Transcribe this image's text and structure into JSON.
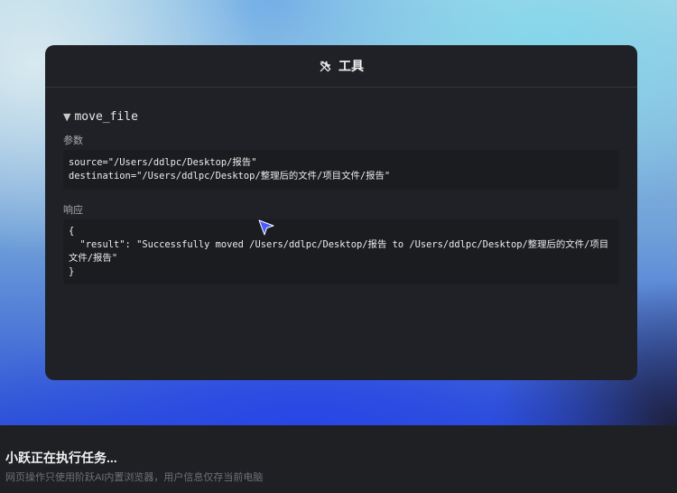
{
  "panel": {
    "title": "工具",
    "title_icon": "tools-icon",
    "function_name": "move_file",
    "collapse_icon": "triangle-down-icon",
    "params_label": "参数",
    "params_lines": [
      "source=\"/Users/ddlpc/Desktop/报告\"",
      "destination=\"/Users/ddlpc/Desktop/整理后的文件/项目文件/报告\""
    ],
    "response_label": "响应",
    "response_lines": [
      "{",
      "  \"result\": \"Successfully moved /Users/ddlpc/Desktop/报告 to /Users/ddlpc/Desktop/整理后的文件/项目文件/报告\"",
      "}"
    ]
  },
  "footer": {
    "title": "小跃正在执行任务...",
    "subtitle": "网页操作只使用阶跃AI内置浏览器，用户信息仅存当前电脑"
  },
  "colors": {
    "panel_bg": "#1f2126",
    "cursor": "#4a5cff",
    "accent_blue": "#2e52d6"
  }
}
